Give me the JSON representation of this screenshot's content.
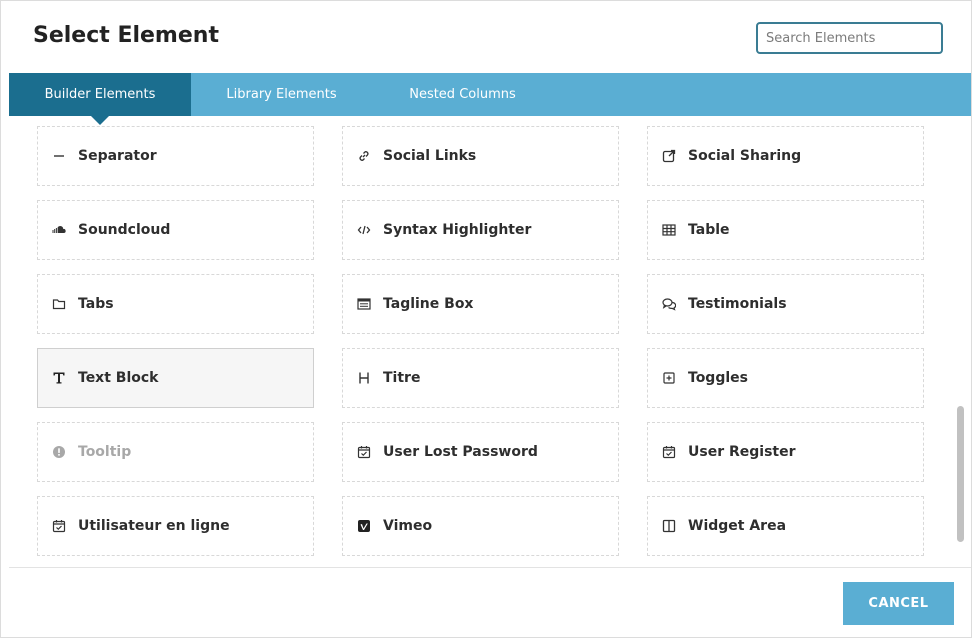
{
  "dialog": {
    "title": "Select Element",
    "search": {
      "placeholder": "Search Elements",
      "value": ""
    }
  },
  "tabs": [
    {
      "label": "Builder Elements",
      "active": true
    },
    {
      "label": "Library Elements",
      "active": false
    },
    {
      "label": "Nested Columns",
      "active": false
    }
  ],
  "elements": [
    {
      "label": "Separator",
      "icon": "minus-icon"
    },
    {
      "label": "Social Links",
      "icon": "link-icon"
    },
    {
      "label": "Social Sharing",
      "icon": "external-link-icon"
    },
    {
      "label": "Soundcloud",
      "icon": "soundcloud-icon"
    },
    {
      "label": "Syntax Highlighter",
      "icon": "code-icon"
    },
    {
      "label": "Table",
      "icon": "table-icon"
    },
    {
      "label": "Tabs",
      "icon": "folder-icon"
    },
    {
      "label": "Tagline Box",
      "icon": "tagline-box-icon"
    },
    {
      "label": "Testimonials",
      "icon": "comments-icon"
    },
    {
      "label": "Text Block",
      "icon": "text-t-icon",
      "state": "hover"
    },
    {
      "label": "Titre",
      "icon": "heading-icon"
    },
    {
      "label": "Toggles",
      "icon": "plus-square-icon"
    },
    {
      "label": "Tooltip",
      "icon": "info-circle-icon",
      "state": "disabled"
    },
    {
      "label": "User Lost Password",
      "icon": "calendar-check-icon"
    },
    {
      "label": "User Register",
      "icon": "calendar-check-icon"
    },
    {
      "label": "Utilisateur en ligne",
      "icon": "calendar-check-icon"
    },
    {
      "label": "Vimeo",
      "icon": "vimeo-icon"
    },
    {
      "label": "Widget Area",
      "icon": "columns-icon"
    }
  ],
  "footer": {
    "cancel_label": "CANCEL"
  },
  "colors": {
    "tab_bar": "#5aaed3",
    "tab_active": "#1b6e8f",
    "search_border": "#3a7c93",
    "cancel_button": "#5aaed3"
  }
}
